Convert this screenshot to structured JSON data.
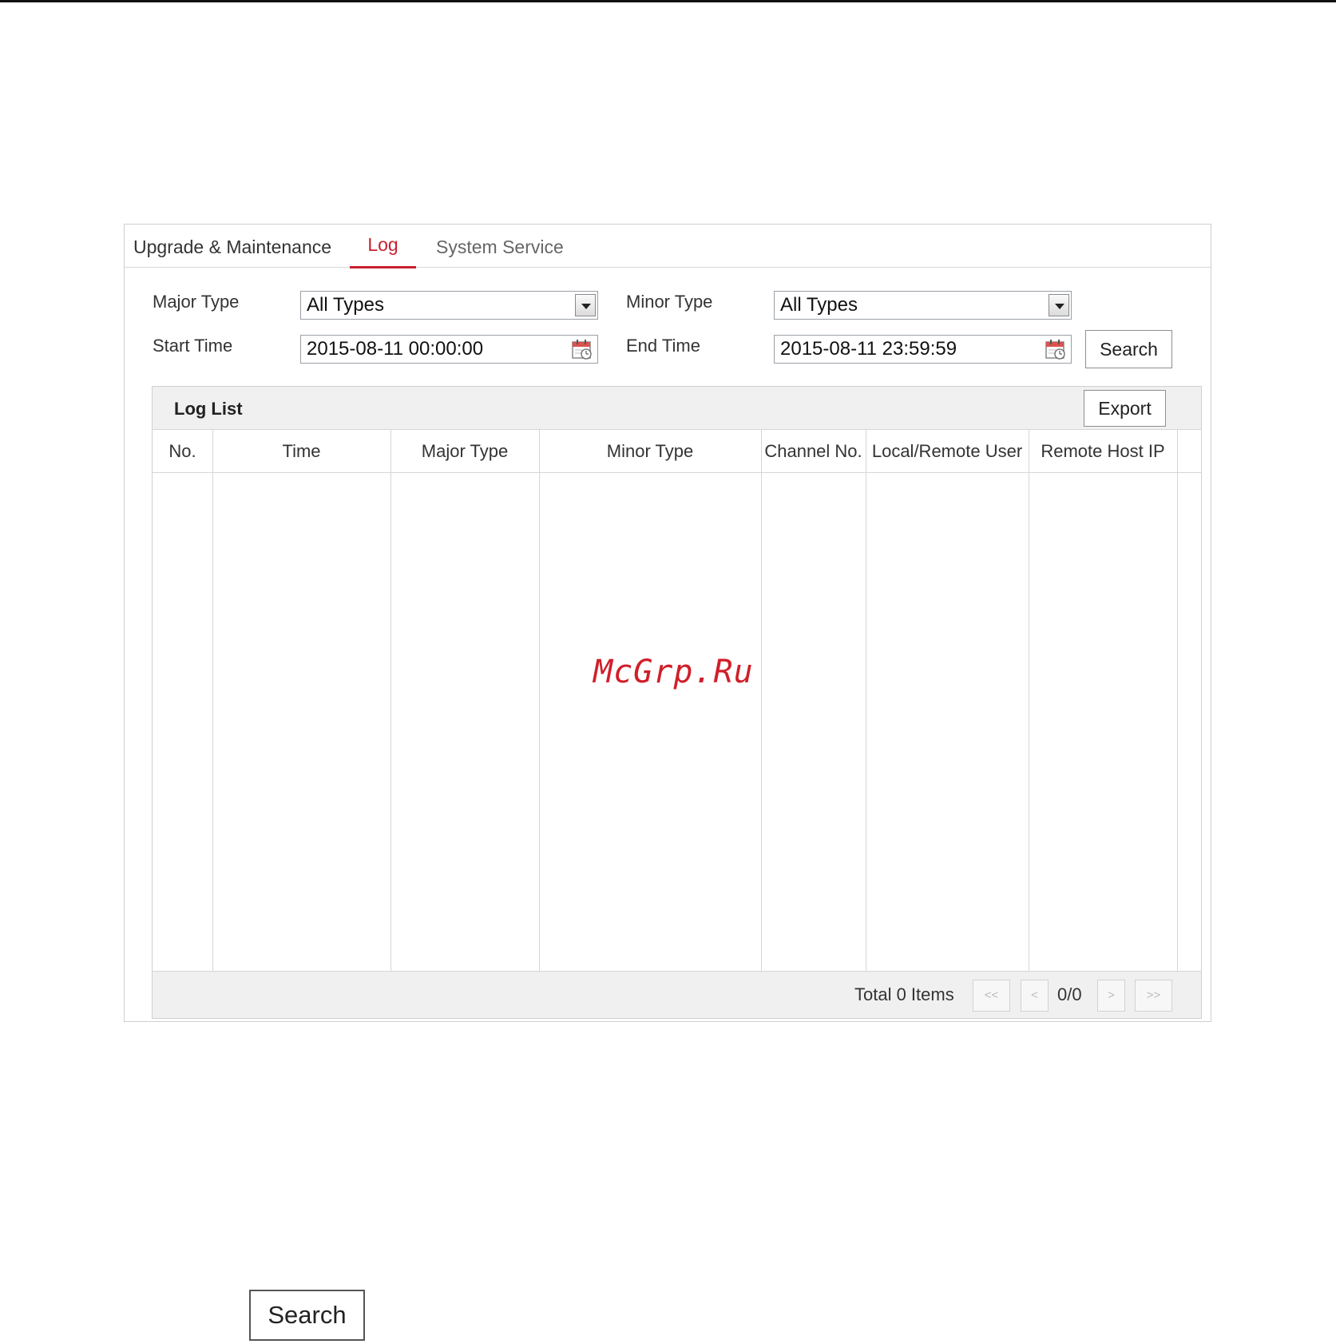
{
  "tabs": [
    {
      "label": "Upgrade & Maintenance"
    },
    {
      "label": "Log"
    },
    {
      "label": "System Service"
    }
  ],
  "filters": {
    "major_type_label": "Major Type",
    "major_type_value": "All Types",
    "minor_type_label": "Minor Type",
    "minor_type_value": "All Types",
    "start_time_label": "Start Time",
    "start_time_value": "2015-08-11 00:00:00",
    "end_time_label": "End Time",
    "end_time_value": "2015-08-11 23:59:59",
    "search_label": "Search"
  },
  "log_list": {
    "title": "Log List",
    "export_label": "Export",
    "columns": [
      "No.",
      "Time",
      "Major Type",
      "Minor Type",
      "Channel No.",
      "Local/Remote User",
      "Remote Host IP"
    ]
  },
  "pagination": {
    "total": "Total 0 Items",
    "first": "<<",
    "prev": "<",
    "page": "0/0",
    "next": ">",
    "last": ">>"
  },
  "watermark": "McGrp.Ru",
  "standalone_button": "Search",
  "colors": {
    "accent": "#c8202f"
  }
}
